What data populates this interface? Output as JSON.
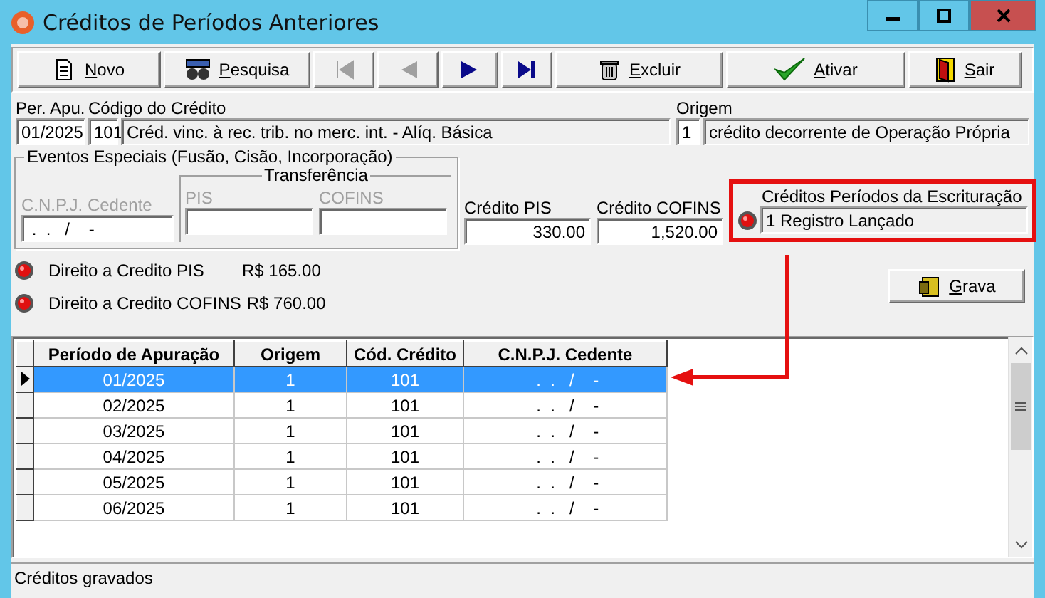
{
  "window": {
    "title": "Créditos de Períodos Anteriores"
  },
  "toolbar": [
    {
      "kind": "new",
      "label": "Novo",
      "disabled": false
    },
    {
      "kind": "search",
      "label": "Pesquisa",
      "disabled": false
    },
    {
      "kind": "first",
      "disabled": true
    },
    {
      "kind": "prev",
      "disabled": true
    },
    {
      "kind": "next",
      "disabled": false
    },
    {
      "kind": "last",
      "disabled": false
    },
    {
      "kind": "delete",
      "label": "Excluir",
      "disabled": false
    },
    {
      "kind": "activate",
      "label": "Ativar",
      "disabled": false
    },
    {
      "kind": "exit",
      "label": "Sair",
      "disabled": false
    }
  ],
  "per_apu": {
    "label": "Per. Apu.",
    "value": "01/2025"
  },
  "codigo_credito": {
    "label": "Código do Crédito",
    "code": "101",
    "description": "Créd. vinc. à rec. trib. no merc. int. - Alíq. Básica"
  },
  "origem": {
    "label": "Origem",
    "code": "1",
    "description": "crédito decorrente de Operação Própria"
  },
  "eventos_especiais": {
    "title": "Eventos Especiais (Fusão, Cisão, Incorporação)",
    "disabled": true,
    "cnpj_cedente": {
      "label": "C.N.P.J. Cedente",
      "value": " .  .   /    -"
    },
    "transferencia": {
      "title": "Transferência",
      "pis": {
        "label": "PIS"
      },
      "cofins": {
        "label": "COFINS"
      }
    }
  },
  "credito_pis": {
    "label": "Crédito PIS",
    "value": "330.00"
  },
  "credito_cofins": {
    "label": "Crédito COFINS",
    "value": "1,520.00"
  },
  "creditos_escrituracao": {
    "label": "Créditos Períodos da Escrituração",
    "value": "1 Registro Lançado",
    "highlighted": true
  },
  "indicators": [
    {
      "label": "Direito a Credito PIS",
      "value": "R$ 165.00"
    },
    {
      "label": "Direito a Credito COFINS",
      "value": "R$ 760.00"
    }
  ],
  "grava_button": {
    "label": "Grava"
  },
  "table": {
    "columns": [
      "Período de Apuração",
      "Origem",
      "Cód. Crédito",
      "C.N.P.J. Cedente"
    ],
    "rows": [
      {
        "cells": [
          "01/2025",
          "1",
          "101",
          " .  .   /    -"
        ],
        "selected": true
      },
      {
        "cells": [
          "02/2025",
          "1",
          "101",
          " .  .   /    -"
        ],
        "selected": false
      },
      {
        "cells": [
          "03/2025",
          "1",
          "101",
          " .  .   /    -"
        ],
        "selected": false
      },
      {
        "cells": [
          "04/2025",
          "1",
          "101",
          " .  .   /    -"
        ],
        "selected": false
      },
      {
        "cells": [
          "05/2025",
          "1",
          "101",
          " .  .   /    -"
        ],
        "selected": false
      },
      {
        "cells": [
          "06/2025",
          "1",
          "101",
          " .  .   /    -"
        ],
        "selected": false
      }
    ]
  },
  "status_bar": "Créditos gravados"
}
